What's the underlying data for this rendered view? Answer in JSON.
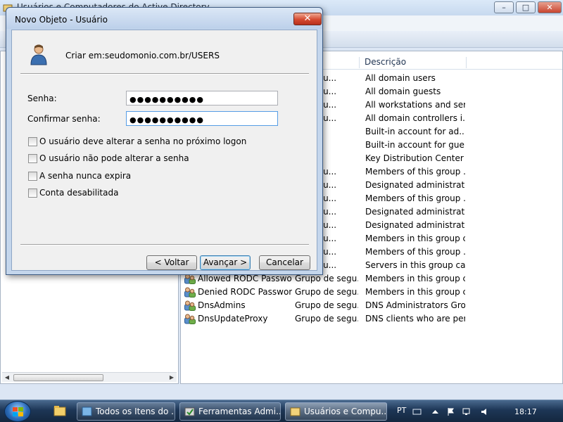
{
  "background_window": {
    "title": "Usuários e Computadores do Active Directory",
    "caption_buttons": [
      "–",
      "□",
      "✕"
    ]
  },
  "list": {
    "columns": [
      "Descrição"
    ],
    "rows": [
      {
        "name": "",
        "type": "de segu...",
        "desc": "All domain users"
      },
      {
        "name": "",
        "type": "de segu...",
        "desc": "All domain guests"
      },
      {
        "name": "",
        "type": "de segu...",
        "desc": "All workstations and ser..."
      },
      {
        "name": "",
        "type": "de segu...",
        "desc": "All domain controllers i..."
      },
      {
        "name": "",
        "type": "",
        "desc": "Built-in account for ad..."
      },
      {
        "name": "",
        "type": "",
        "desc": "Built-in account for gue..."
      },
      {
        "name": "",
        "type": "",
        "desc": "Key Distribution Center ..."
      },
      {
        "name": "",
        "type": "de segu...",
        "desc": "Members of this group ..."
      },
      {
        "name": "",
        "type": "de segu...",
        "desc": "Designated administrato..."
      },
      {
        "name": "",
        "type": "de segu...",
        "desc": "Members of this group ..."
      },
      {
        "name": "",
        "type": "de segu...",
        "desc": "Designated administrato..."
      },
      {
        "name": "",
        "type": "de segu...",
        "desc": "Designated administrato..."
      },
      {
        "name": "",
        "type": "de segu...",
        "desc": "Members in this group c..."
      },
      {
        "name": "",
        "type": "de segu...",
        "desc": "Members of this group ..."
      },
      {
        "name": "",
        "type": "de segu...",
        "desc": "Servers in this group can..."
      },
      {
        "name": "Allowed RODC Passwo...",
        "type": "Grupo de segu...",
        "desc": "Members in this group c..."
      },
      {
        "name": "Denied RODC Passwor...",
        "type": "Grupo de segu...",
        "desc": "Members in this group c..."
      },
      {
        "name": "DnsAdmins",
        "type": "Grupo de segu...",
        "desc": "DNS Administrators Gro..."
      },
      {
        "name": "DnsUpdateProxy",
        "type": "Grupo de segu...",
        "desc": "DNS clients who are per..."
      }
    ]
  },
  "dialog": {
    "title": "Novo Objeto - Usuário",
    "close_label": "✕",
    "create_in_label": "Criar em:",
    "create_in_path": "seudomonio.com.br/USERS",
    "password_label": "Senha:",
    "password_value": "●●●●●●●●●●",
    "confirm_label": "Confirmar senha:",
    "confirm_value": "●●●●●●●●●●",
    "options": [
      {
        "label": "O usuário deve alterar a senha no próximo logon",
        "checked": false
      },
      {
        "label": "O usuário não pode alterar a senha",
        "checked": false
      },
      {
        "label": "A senha nunca expira",
        "checked": false
      },
      {
        "label": "Conta desabilitada",
        "checked": false
      }
    ],
    "back_label": "< Voltar",
    "next_label": "Avançar >",
    "cancel_label": "Cancelar"
  },
  "taskbar": {
    "buttons": [
      {
        "label": "Todos os Itens do ..."
      },
      {
        "label": "Ferramentas Admi..."
      },
      {
        "label": "Usuários e Compu..."
      }
    ],
    "language": "PT",
    "clock": "18:17"
  },
  "colors": {
    "dialog_frame": "#c4d6ec",
    "close_red": "#d54a30",
    "taskbar": "#1d3656"
  },
  "icons": [
    "user-icon",
    "group-icon",
    "folder-icon",
    "windows-logo-icon",
    "flag-icon",
    "volume-icon",
    "network-icon"
  ]
}
